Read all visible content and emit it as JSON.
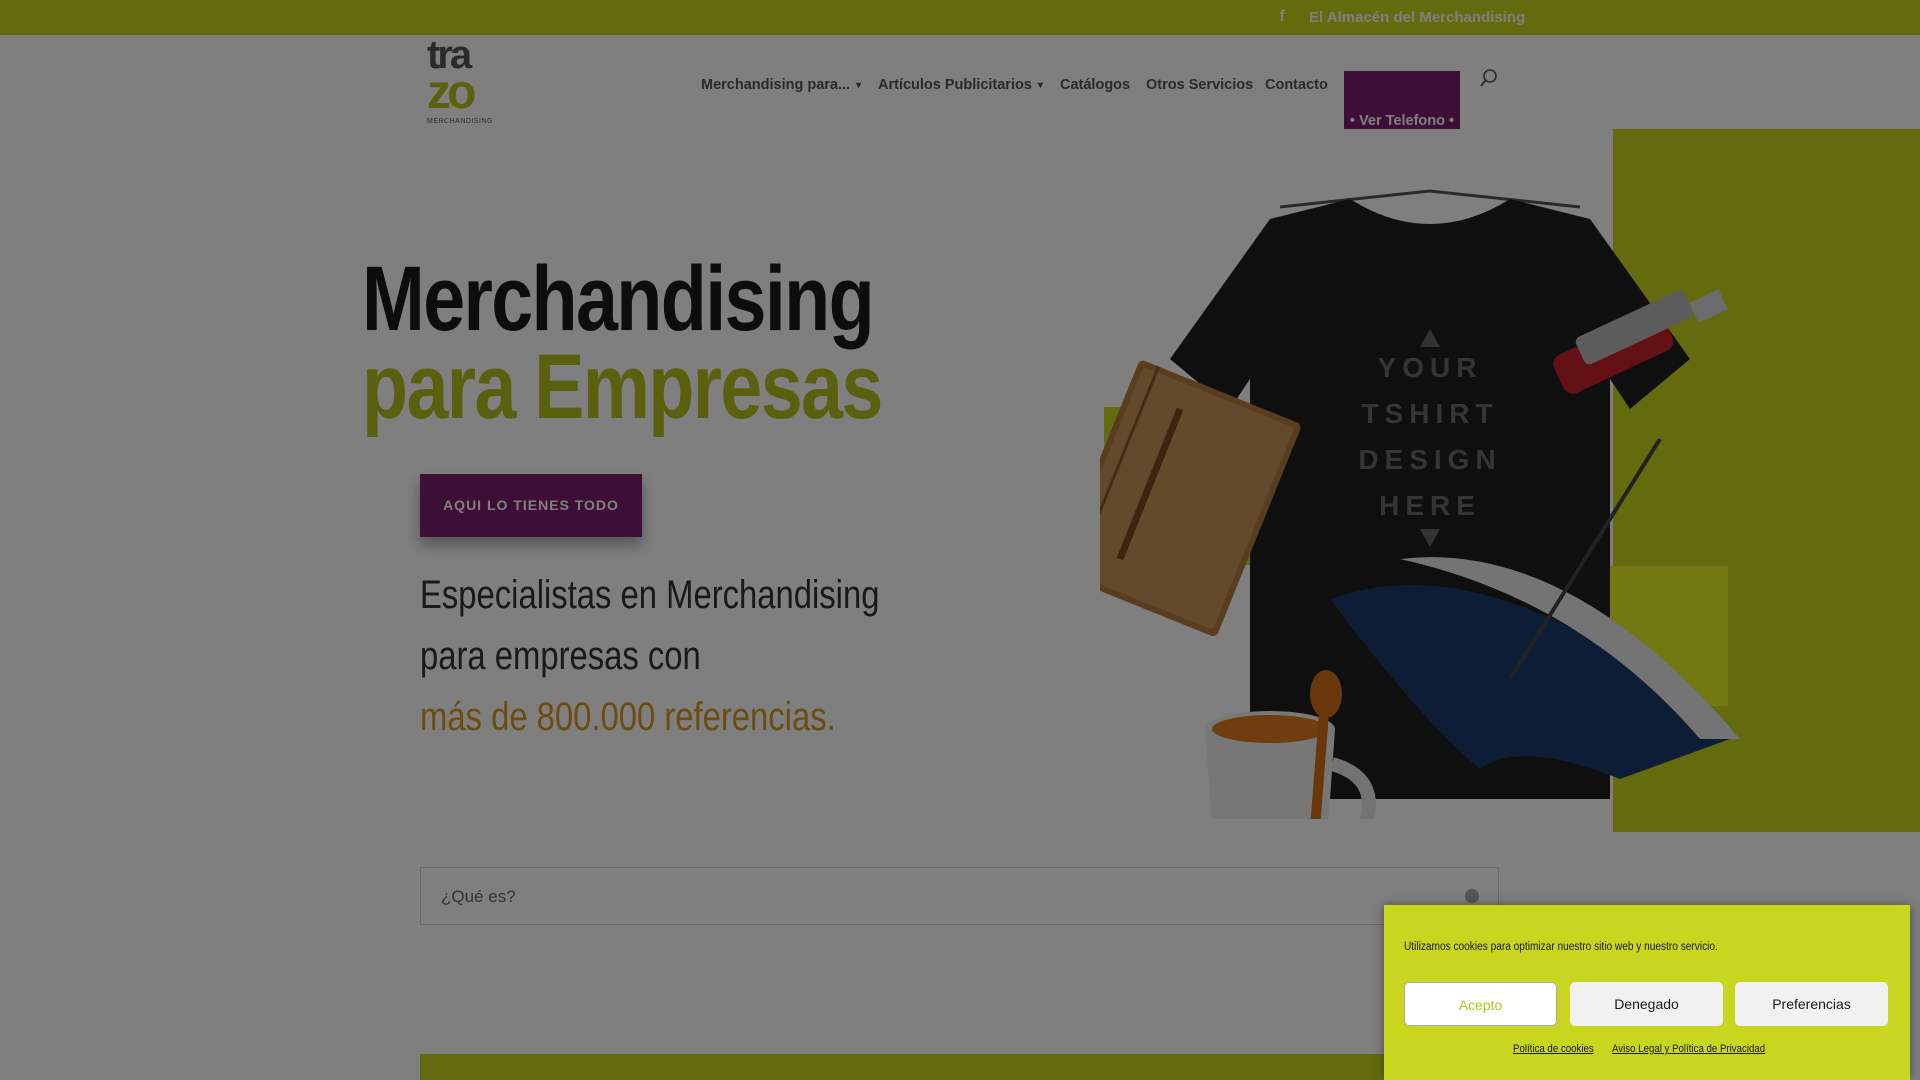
{
  "topbar": {
    "facebook_icon": "f",
    "link": "El Almacén del Merchandising"
  },
  "logo": {
    "line1": "tra",
    "line2": "zo",
    "line3": "MERCHANDISING"
  },
  "nav": {
    "items": [
      {
        "label": "Merchandising para...",
        "has_dropdown": true
      },
      {
        "label": "Artículos Publicitarios",
        "has_dropdown": true
      },
      {
        "label": "Catálogos",
        "has_dropdown": false
      },
      {
        "label": "Otros Servicios",
        "has_dropdown": false
      },
      {
        "label": "Contacto",
        "has_dropdown": false
      }
    ],
    "phone_button": "• Ver Telefono •",
    "chevron": "▾"
  },
  "hero": {
    "title_line1": "Merchandising",
    "title_line2": "para Empresas",
    "cta_label": "AQUI LO TIENES TODO",
    "sub_line1": "Especialistas en Merchandising",
    "sub_line2": "para empresas con",
    "sub_line3": "más de 800.000 referencias.",
    "tshirt_text": [
      "YOUR",
      "TSHIRT",
      "DESIGN",
      "HERE"
    ]
  },
  "search": {
    "placeholder": "¿Qué es?"
  },
  "cookie_banner": {
    "message": "Utilizamos cookies para optimizar nuestro sitio web y nuestro servicio.",
    "accept": "Acepto",
    "deny": "Denegado",
    "preferences": "Preferencias",
    "cookie_policy": "Política de cookies",
    "legal_policy": "Aviso Legal y Política de Privacidad"
  },
  "colors": {
    "brand_green": "#c9d61f",
    "brand_purple": "#7a1f6e",
    "accent_orange": "#d99a20"
  },
  "icons": [
    "facebook-icon",
    "search-icon",
    "chevron-down-icon"
  ]
}
